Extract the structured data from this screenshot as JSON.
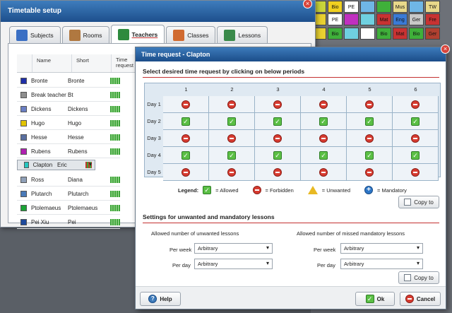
{
  "bg_timetable": {
    "rows": [
      [
        "Bio",
        "Mus",
        "",
        "TW"
      ],
      [
        "Mat",
        "Eng",
        "Ger",
        "Fre"
      ],
      [
        "Bio",
        "Mat",
        "Bio",
        "Ger"
      ],
      [
        "",
        "",
        "",
        ""
      ]
    ]
  },
  "main_window": {
    "title": "Timetable setup",
    "tabs": [
      {
        "label": "Subjects",
        "icon": "books-icon"
      },
      {
        "label": "Rooms",
        "icon": "desk-icon"
      },
      {
        "label": "Teachers",
        "icon": "teacher-icon",
        "active": true
      },
      {
        "label": "Classes",
        "icon": "students-icon"
      },
      {
        "label": "Lessons",
        "icon": "blackboard-icon"
      }
    ],
    "columns": [
      "Name",
      "Short",
      "Time request"
    ],
    "teachers": [
      {
        "name": "Bronte",
        "short": "Bronte",
        "color": "#1f2fa8"
      },
      {
        "name": "Break teacher",
        "short": "Bt",
        "color": "#8e8e8e"
      },
      {
        "name": "Dickens",
        "short": "Dickens",
        "color": "#6a7fc4"
      },
      {
        "name": "Hugo",
        "short": "Hugo",
        "color": "#e2c400"
      },
      {
        "name": "Hesse",
        "short": "Hesse",
        "color": "#5a6fa0"
      },
      {
        "name": "Rubens",
        "short": "Rubens",
        "color": "#b01fb0"
      },
      {
        "name": "Clapton",
        "short": "Eric",
        "color": "#26c6c0",
        "selected": true
      },
      {
        "name": "Ross",
        "short": "Diana",
        "color": "#8fa0b8"
      },
      {
        "name": "Plutarch",
        "short": "Plutarch",
        "color": "#4a7ab8"
      },
      {
        "name": "Ptolemaeus",
        "short": "Ptolemaeus",
        "color": "#1aa335"
      },
      {
        "name": "Pei Xiu",
        "short": "Pei",
        "color": "#1e4a9c"
      }
    ]
  },
  "dialog": {
    "title": "Time request - Clapton",
    "section1": "Select desired time request by clicking on below periods",
    "periods": [
      "1",
      "2",
      "3",
      "4",
      "5",
      "6"
    ],
    "days": [
      "Day 1",
      "Day 2",
      "Day 3",
      "Day 4",
      "Day 5"
    ],
    "grid": [
      [
        "no",
        "no",
        "no",
        "no",
        "no",
        "no"
      ],
      [
        "ok",
        "ok",
        "ok",
        "ok",
        "ok",
        "ok"
      ],
      [
        "no",
        "no",
        "no",
        "no",
        "no",
        "no"
      ],
      [
        "ok",
        "ok",
        "ok",
        "ok",
        "ok",
        "ok"
      ],
      [
        "no",
        "no",
        "no",
        "no",
        "no",
        "no"
      ]
    ],
    "legend": {
      "title": "Legend:",
      "allowed": "= Allowed",
      "forbidden": "= Forbidden",
      "unwanted": "= Unwanted",
      "mandatory": "= Mandatory"
    },
    "copy_to": "Copy to",
    "section2": "Settings for unwanted and mandatory lessons",
    "left_group": {
      "title": "Allowed number of unwanted lessons",
      "per_week_label": "Per week",
      "per_week_value": "Arbitrary",
      "per_day_label": "Per day",
      "per_day_value": "Arbitrary"
    },
    "right_group": {
      "title": "Allowed number of missed mandatory lessons",
      "per_week_label": "Per week",
      "per_week_value": "Arbitrary",
      "per_day_label": "Per day",
      "per_day_value": "Arbitrary"
    },
    "help": "Help",
    "ok": "Ok",
    "cancel": "Cancel"
  }
}
